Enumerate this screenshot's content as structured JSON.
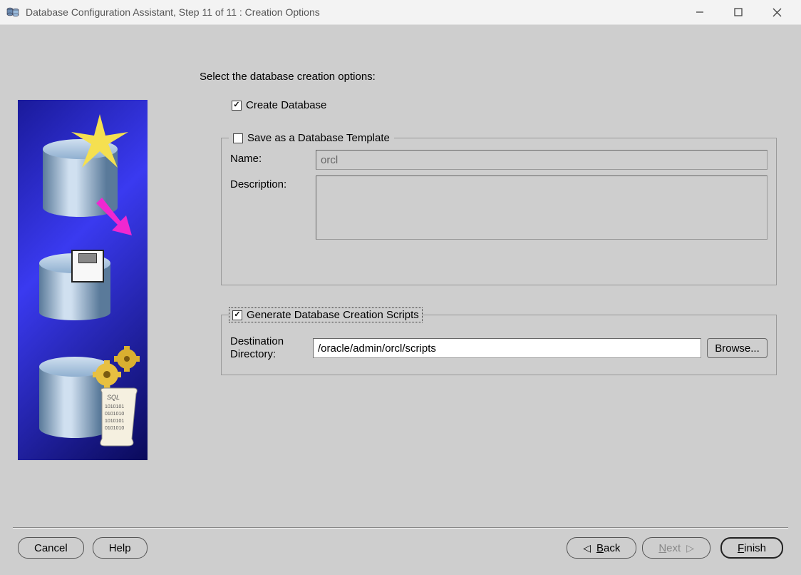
{
  "window": {
    "title": "Database Configuration Assistant, Step 11 of 11 : Creation Options"
  },
  "main": {
    "heading": "Select the database creation options:",
    "create_db": {
      "checked": true,
      "label": "Create Database"
    },
    "template": {
      "checked": false,
      "legend": "Save as a Database Template",
      "name_label": "Name:",
      "name_value": "orcl",
      "desc_label": "Description:",
      "desc_value": ""
    },
    "scripts": {
      "checked": true,
      "legend": "Generate Database Creation Scripts",
      "dest_label": "Destination\nDirectory:",
      "dest_value": "/oracle/admin/orcl/scripts",
      "browse_label": "Browse..."
    }
  },
  "buttons": {
    "cancel": "Cancel",
    "help": "Help",
    "back": "Back",
    "next": "Next",
    "finish": "Finish"
  }
}
